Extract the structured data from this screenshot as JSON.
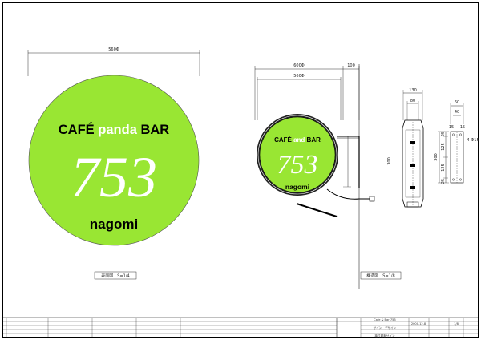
{
  "sign": {
    "line1_a": "CAFÉ ",
    "line1_b": "pand",
    "line1_c": "a",
    "line1_d": " BAR",
    "number": "753",
    "name": "nagomi",
    "small_line1_a": "CAFÉ ",
    "small_line1_b": "and",
    "small_line1_c": " BAR",
    "small_number": "753",
    "small_name": "nagomi"
  },
  "colors": {
    "sign_green": "#99e633",
    "accent_white": "#ffffff",
    "line": "#000000"
  },
  "dimensions": {
    "front_width": "560Φ",
    "side_outer": "600Φ",
    "side_arm": "100",
    "side_inner": "560Φ",
    "bracket_height": "300",
    "section_top": "130",
    "section_inner": "80",
    "plate_top": "60",
    "plate_inner": "40",
    "plate_hole": "4-Φ15",
    "plate_v1": "25",
    "plate_v2": "125",
    "plate_v3": "125",
    "plate_v4": "25",
    "plate_total": "300",
    "plate_seg_a": "15",
    "plate_seg_b": "15"
  },
  "captions": {
    "front": "表面図　S=1/4",
    "structure": "構造図　S=1/8"
  },
  "title_block": {
    "project": "Cafe & Bar 753",
    "sign": "サイン　デザイン",
    "drawing": "袖付看板サイン",
    "date": "2000.12.8",
    "scale": "1/8"
  }
}
